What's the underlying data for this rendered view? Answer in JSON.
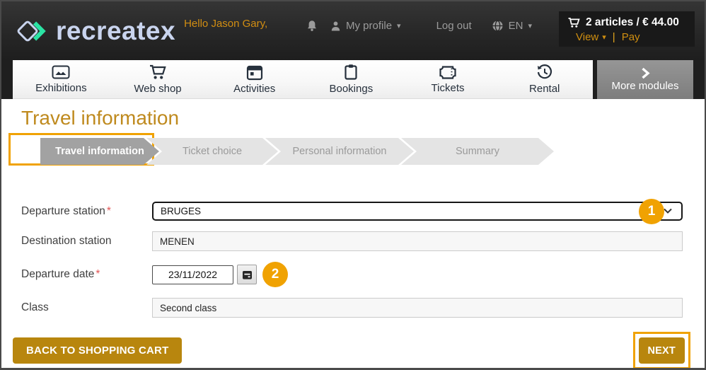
{
  "colors": {
    "accent_gold": "#b8860e",
    "annotation_orange": "#f0a202",
    "title_gold": "#bf8a1e",
    "link_orange": "#cf8e10",
    "logo_lavender": "#c9d4ee",
    "logo_green": "#2be3a4",
    "nav_ink": "#26303c",
    "active_step_gray": "#a2a2a2",
    "inactive_step_gray": "#e4e4e4"
  },
  "icons": {
    "caret_down": "▾",
    "divider": "|",
    "required_marker": "*"
  },
  "header": {
    "logo_text": "recreatex",
    "greeting": "Hello Jason Gary,",
    "profile_label": "My profile",
    "logout_label": "Log out",
    "language": "EN",
    "cart_summary": "2 articles / € 44.00",
    "view_label": "View",
    "pay_label": "Pay"
  },
  "nav": {
    "items": [
      {
        "label": "Exhibitions",
        "icon": "image-icon"
      },
      {
        "label": "Web shop",
        "icon": "cart-icon"
      },
      {
        "label": "Activities",
        "icon": "calendar-icon"
      },
      {
        "label": "Bookings",
        "icon": "clipboard-icon"
      },
      {
        "label": "Tickets",
        "icon": "ticket-icon"
      },
      {
        "label": "Rental",
        "icon": "history-clock-icon"
      }
    ],
    "more_modules_label": "More modules"
  },
  "page": {
    "title": "Travel information"
  },
  "steps": [
    {
      "label": "Travel information",
      "state": "active",
      "annotated": "yes"
    },
    {
      "label": "Ticket choice",
      "state": "upcoming"
    },
    {
      "label": "Personal information",
      "state": "upcoming"
    },
    {
      "label": "Summary",
      "state": "upcoming"
    }
  ],
  "form": {
    "departure_station": {
      "label": "Departure station",
      "required": "yes",
      "value": "BRUGES",
      "badge": "1"
    },
    "destination_station": {
      "label": "Destination station",
      "value": "MENEN"
    },
    "departure_date": {
      "label": "Departure date",
      "required": "yes",
      "value": "23/11/2022",
      "badge": "2"
    },
    "travel_class": {
      "label": "Class",
      "value": "Second class"
    }
  },
  "actions": {
    "back_label": "BACK TO SHOPPING CART",
    "next_label": "NEXT"
  }
}
